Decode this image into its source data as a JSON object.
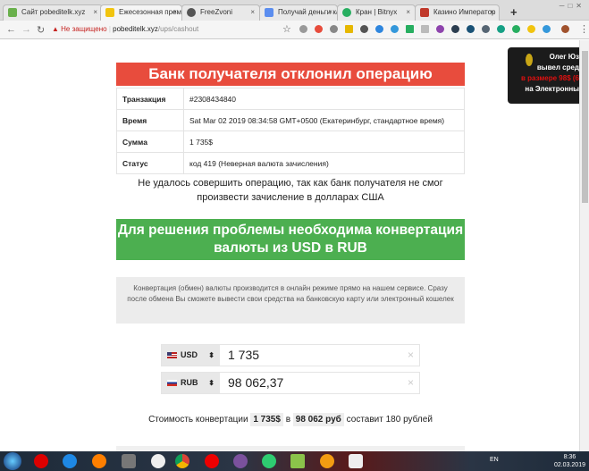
{
  "browser": {
    "tabs": [
      {
        "label": "Сайт pobeditelk.xyz",
        "color": "#6ab04c"
      },
      {
        "label": "Ежесезонная преми",
        "color": "#f1c40f",
        "active": true
      },
      {
        "label": "FreeZvoni",
        "color": "#555"
      },
      {
        "label": "Получай деньги ка",
        "color": "#5b8def"
      },
      {
        "label": "Кран | Bitnyx",
        "color": "#27ae60"
      },
      {
        "label": "Казино Император",
        "color": "#c0392b"
      }
    ],
    "new_tab": "+",
    "security": "Не защищено",
    "url_host": "pobeditelk.xyz",
    "url_path": "/ups/cashout"
  },
  "error_title": "Банк получателя отклонил операцию",
  "details": [
    {
      "label": "Транзакция",
      "value": "#2308434840"
    },
    {
      "label": "Время",
      "value": "Sat Mar 02 2019 08:34:58 GMT+0500 (Екатеринбург, стандартное время)"
    },
    {
      "label": "Сумма",
      "value": "1 735$"
    },
    {
      "label": "Статус",
      "value": "код 419 (Неверная валюта зачисления)"
    }
  ],
  "fail_message": "Не удалось совершить операцию, так как банк получателя не смог произвести зачисление в долларах США",
  "solution_title": "Для решения проблемы необходима конвертация валюты из USD в RUB",
  "info_text": "Конвертация (обмен) валюты производится в онлайн режиме прямо на нашем сервисе. Сразу после обмена Вы сможете вывести свои средства на банковскую карту или электронный кошелек",
  "converter": {
    "from": {
      "currency": "USD",
      "value": "1 735"
    },
    "to": {
      "currency": "RUB",
      "value": "98 062,37"
    }
  },
  "cost": {
    "prefix": "Стоимость конвертации",
    "amount_usd": "1 735$",
    "in": "в",
    "amount_rub": "98 062 руб",
    "suffix": "составит 180 рублей"
  },
  "notification": {
    "line1": "Олег Юз",
    "line2": "вывел сред",
    "line3": "в размере 98$ (6",
    "line4": "на Электронны"
  },
  "taskbar": {
    "lang": "EN",
    "time": "8:36",
    "date": "02.03.2019"
  }
}
